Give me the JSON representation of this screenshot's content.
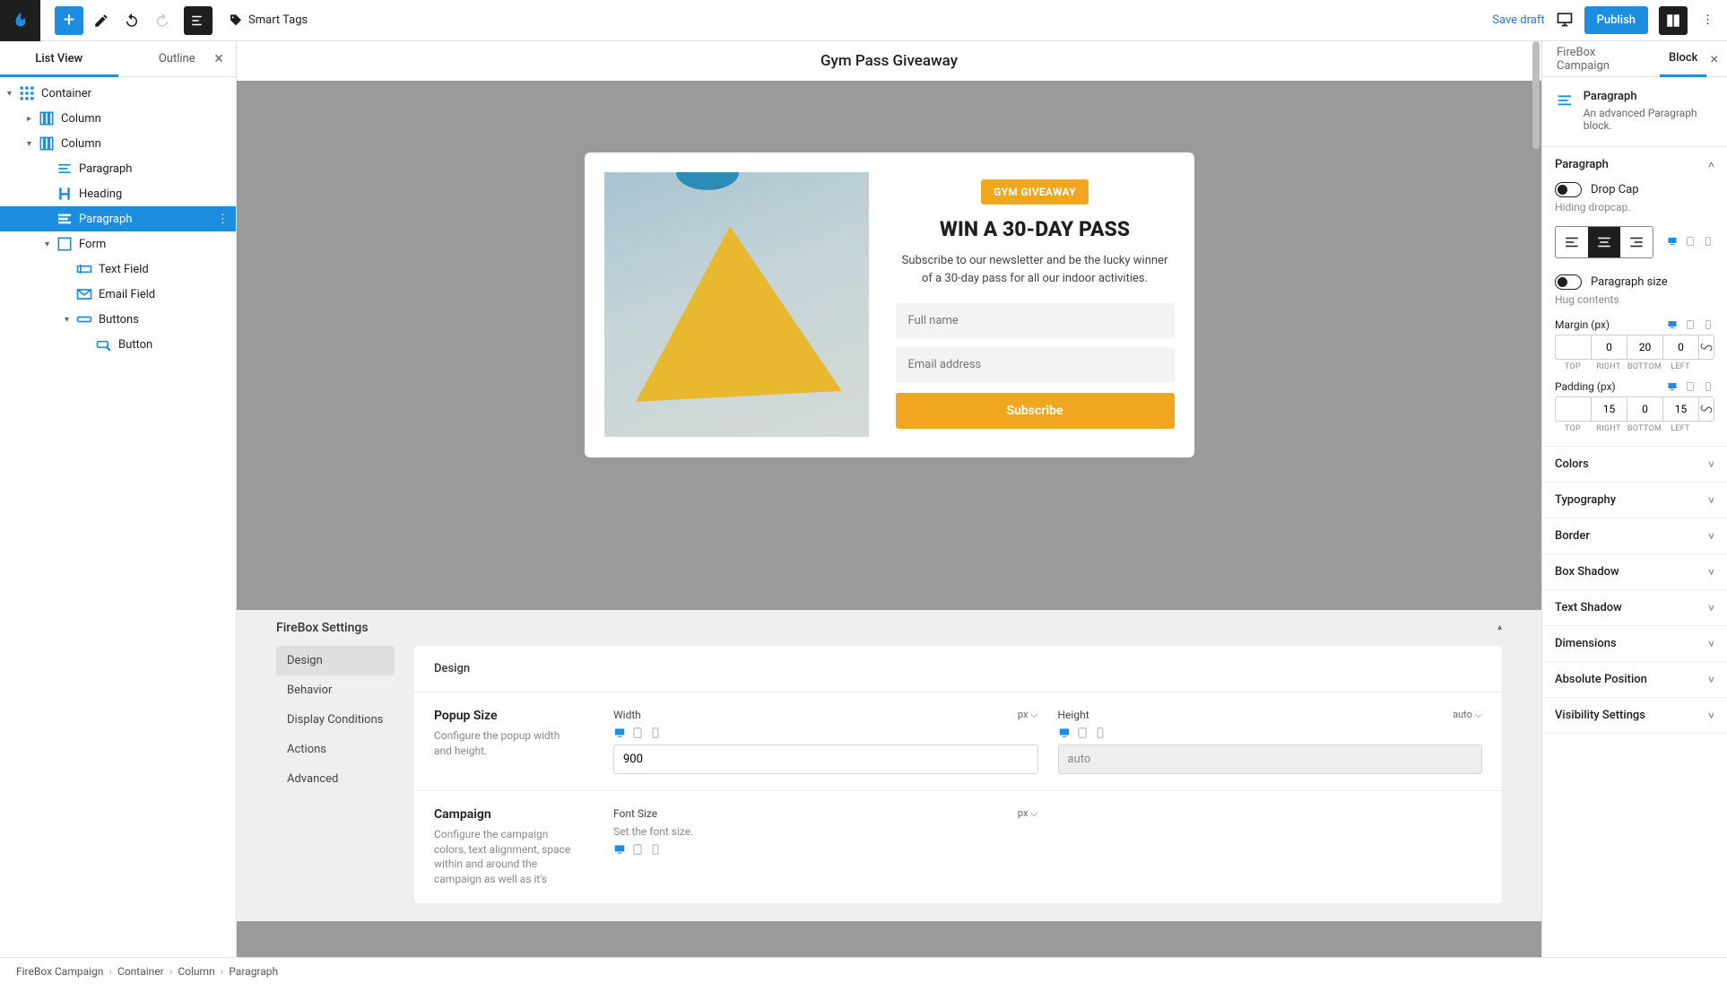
{
  "topBar": {
    "smartTags": "Smart Tags",
    "saveDraft": "Save draft",
    "publish": "Publish"
  },
  "leftPanel": {
    "tabs": {
      "listView": "List View",
      "outline": "Outline"
    },
    "tree": {
      "container": "Container",
      "column1": "Column",
      "column2": "Column",
      "paragraph1": "Paragraph",
      "heading": "Heading",
      "paragraph2": "Paragraph",
      "form": "Form",
      "textField": "Text Field",
      "emailField": "Email Field",
      "buttons": "Buttons",
      "button": "Button"
    }
  },
  "canvas": {
    "title": "Gym Pass Giveaway",
    "badge": "GYM GIVEAWAY",
    "heading": "WIN A 30-DAY PASS",
    "description": "Subscribe to our newsletter and be the lucky winner of a 30-day pass for all our indoor activities.",
    "fullNamePlaceholder": "Full name",
    "emailPlaceholder": "Email address",
    "subscribe": "Subscribe"
  },
  "fireBoxSettings": {
    "title": "FireBox Settings",
    "tabs": {
      "design": "Design",
      "behavior": "Behavior",
      "displayConditions": "Display Conditions",
      "actions": "Actions",
      "advanced": "Advanced"
    },
    "designSection": "Design",
    "popupSize": {
      "title": "Popup Size",
      "desc": "Configure the popup width and height.",
      "widthLabel": "Width",
      "widthValue": "900",
      "widthUnit": "px",
      "heightLabel": "Height",
      "heightValue": "auto",
      "heightUnit": "auto"
    },
    "campaign": {
      "title": "Campaign",
      "desc": "Configure the campaign colors, text alignment, space within and around the campaign as well as it's",
      "fontSizeLabel": "Font Size",
      "fontSizeDesc": "Set the font size.",
      "fontSizeUnit": "px"
    }
  },
  "rightPanel": {
    "tabs": {
      "campaign": "FireBox Campaign",
      "block": "Block"
    },
    "block": {
      "title": "Paragraph",
      "desc": "An advanced Paragraph block."
    },
    "paragraphSection": "Paragraph",
    "dropCap": {
      "label": "Drop Cap",
      "hint": "Hiding dropcap."
    },
    "paragraphSize": {
      "label": "Paragraph size",
      "hint": "Hug contents"
    },
    "margin": {
      "label": "Margin (px)",
      "top": "",
      "right": "0",
      "bottom": "20",
      "left": "0",
      "sideLabels": {
        "top": "TOP",
        "right": "RIGHT",
        "bottom": "BOTTOM",
        "left": "LEFT"
      }
    },
    "padding": {
      "label": "Padding (px)",
      "top": "",
      "right": "15",
      "bottom": "0",
      "left": "15"
    },
    "sections": {
      "colors": "Colors",
      "typography": "Typography",
      "border": "Border",
      "boxShadow": "Box Shadow",
      "textShadow": "Text Shadow",
      "dimensions": "Dimensions",
      "absolutePosition": "Absolute Position",
      "visibility": "Visibility Settings"
    }
  },
  "breadcrumb": {
    "l0": "FireBox Campaign",
    "l1": "Container",
    "l2": "Column",
    "l3": "Paragraph"
  }
}
